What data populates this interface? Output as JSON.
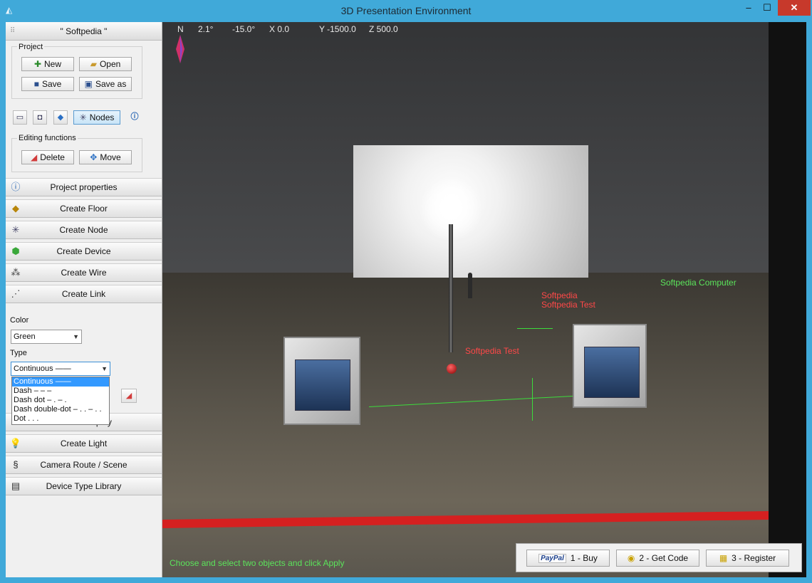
{
  "window": {
    "title": "3D Presentation Environment",
    "minimize": "–",
    "maximize": "☐",
    "close": "✕"
  },
  "panel": {
    "project_name": "\" Softpedia \"",
    "project_group": "Project",
    "new_label": "New",
    "open_label": "Open",
    "save_label": "Save",
    "saveas_label": "Save as",
    "nodes_label": "Nodes",
    "editing_group": "Editing functions",
    "delete_label": "Delete",
    "move_label": "Move",
    "sections": [
      "Project properties",
      "Create Floor",
      "Create Node",
      "Create Device",
      "Create Wire",
      "Create Link",
      "Create Display",
      "Create Light",
      "Camera Route / Scene",
      "Device Type Library"
    ],
    "color_label": "Color",
    "color_value": "Green",
    "type_label": "Type",
    "type_value": "Continuous   ——",
    "type_options": [
      "Continuous   ——",
      "Dash   – – –",
      "Dash dot   – . – .",
      "Dash double-dot   – . . – . .",
      "Dot   . . ."
    ]
  },
  "viewport": {
    "hud": {
      "north": "N",
      "angle1": "2.1°",
      "angle2": "-15.0°",
      "x": "X 0.0",
      "y": "Y -1500.0",
      "z": "Z 500.0"
    },
    "labels": {
      "softpedia": "Softpedia",
      "softpedia_test1": "Softpedia Test",
      "softpedia_test2": "Softpedia Test",
      "computer": "Softpedia Computer"
    },
    "status": "Choose and select two objects and click Apply"
  },
  "paybar": {
    "paypal": "PayPal",
    "buy": "1 - Buy",
    "getcode": "2 - Get Code",
    "register": "3 - Register"
  },
  "colors": {
    "accent": "#40a9d9",
    "link_green": "#3cdc3c",
    "label_red": "#ff4040"
  }
}
